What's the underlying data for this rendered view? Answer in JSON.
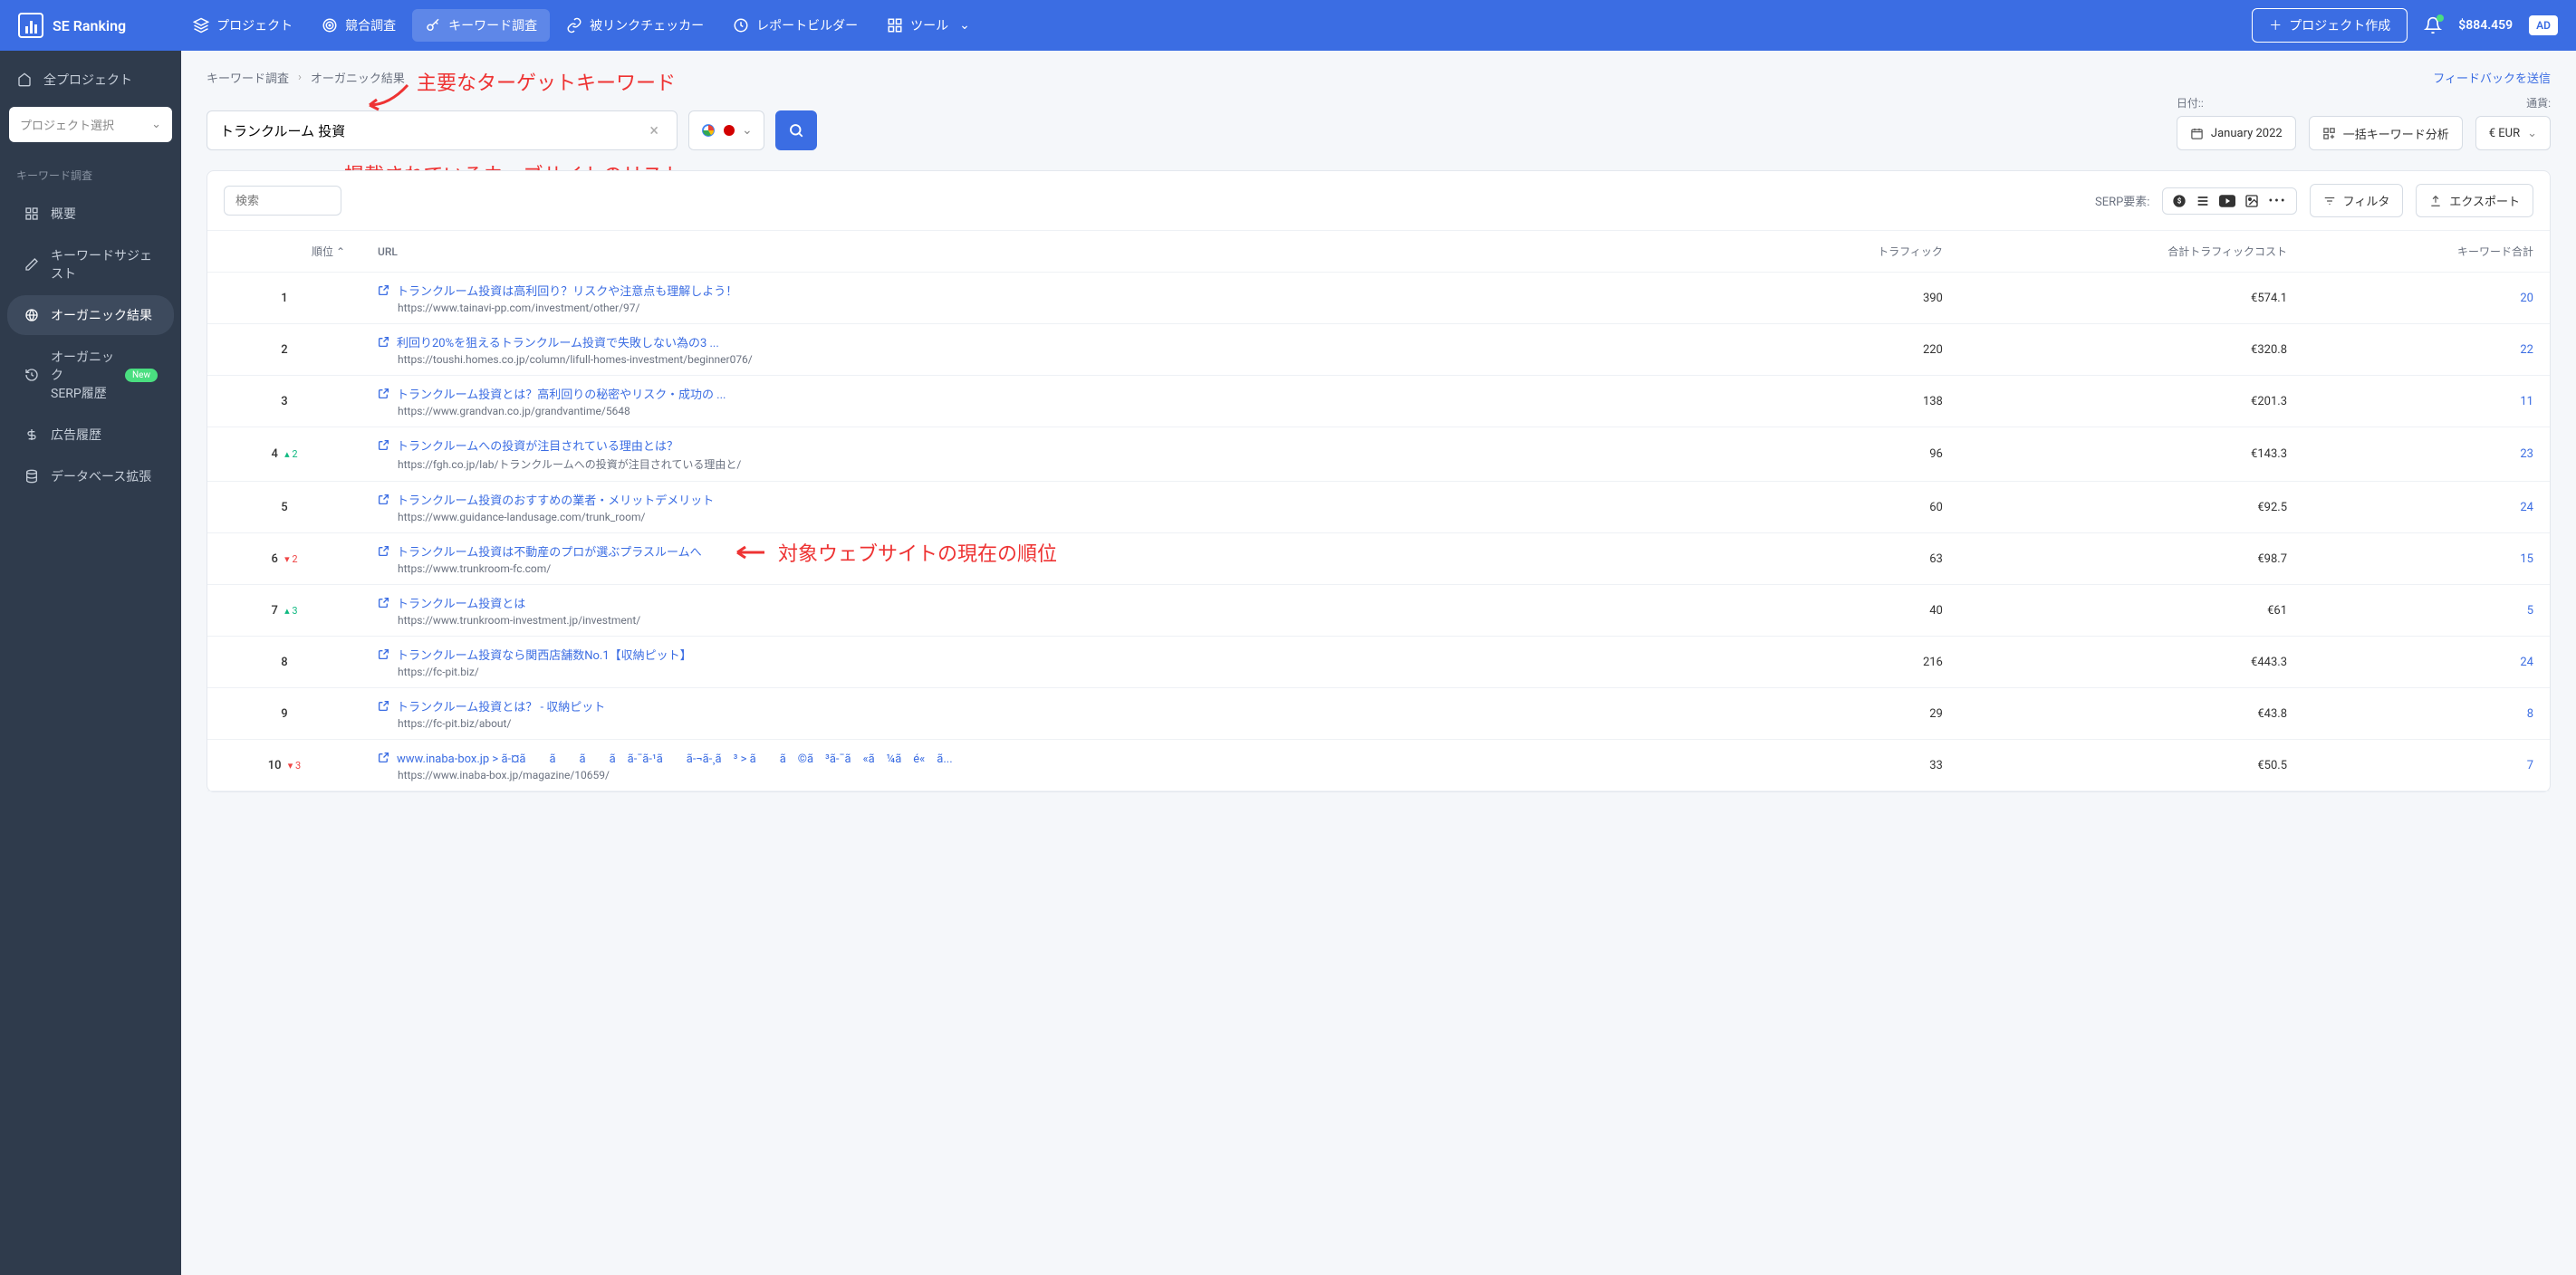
{
  "header": {
    "logo_text": "SE Ranking",
    "nav": [
      {
        "label": "プロジェクト",
        "icon": "layers"
      },
      {
        "label": "競合調査",
        "icon": "target"
      },
      {
        "label": "キーワード調査",
        "icon": "key",
        "active": true
      },
      {
        "label": "被リンクチェッカー",
        "icon": "link"
      },
      {
        "label": "レポートビルダー",
        "icon": "clock"
      },
      {
        "label": "ツール",
        "icon": "grid"
      }
    ],
    "create_project": "プロジェクト作成",
    "balance": "$884.459",
    "ad_badge": "AD"
  },
  "sidebar": {
    "all_projects": "全プロジェクト",
    "project_select_placeholder": "プロジェクト選択",
    "section_title": "キーワード調査",
    "items": [
      {
        "label": "概要",
        "icon": "grid"
      },
      {
        "label": "キーワードサジェスト",
        "icon": "pencil"
      },
      {
        "label": "オーガニック結果",
        "icon": "globe",
        "active": true
      },
      {
        "label": "オーガニック\nSERP履歴",
        "icon": "history",
        "badge": "New"
      },
      {
        "label": "広告履歴",
        "icon": "dollar"
      },
      {
        "label": "データベース拡張",
        "icon": "database"
      }
    ]
  },
  "breadcrumb": {
    "a": "キーワード調査",
    "b": "オーガニック結果"
  },
  "feedback": "フィードバックを送信",
  "keyword_input_value": "トランクルーム 投資",
  "date_label": "日付::",
  "date_value": "January 2022",
  "bulk_analysis": "一括キーワード分析",
  "currency_label": "通貨:",
  "currency_value": "€ EUR",
  "annotations": {
    "a1": "主要なターゲットキーワード",
    "a2": "掲載されているウェブサイトのリスト",
    "a3": "対象ウェブサイトの現在の順位"
  },
  "table": {
    "search_placeholder": "検索",
    "serp_label": "SERP要素:",
    "filter": "フィルタ",
    "export": "エクスポート",
    "cols": {
      "pos": "順位",
      "url": "URL",
      "traffic": "トラフィック",
      "cost": "合計トラフィックコスト",
      "kw": "キーワード合計"
    },
    "rows": [
      {
        "pos": "1",
        "title": "トランクルーム投資は高利回り？リスクや注意点も理解しよう！",
        "url": "https://www.tainavi-pp.com/investment/other/97/",
        "traffic": "390",
        "cost": "€574.1",
        "kw": "20"
      },
      {
        "pos": "2",
        "title": "利回り20%を狙えるトランクルーム投資で失敗しない為の3 ...",
        "url": "https://toushi.homes.co.jp/column/lifull-homes-investment/beginner076/",
        "traffic": "220",
        "cost": "€320.8",
        "kw": "22"
      },
      {
        "pos": "3",
        "title": "トランクルーム投資とは？高利回りの秘密やリスク・成功の ...",
        "url": "https://www.grandvan.co.jp/grandvantime/5648",
        "traffic": "138",
        "cost": "€201.3",
        "kw": "11"
      },
      {
        "pos": "4",
        "chg": "▴ 2",
        "chg_dir": "up",
        "title": "トランクルームへの投資が注目されている理由とは？",
        "url": "https://fgh.co.jp/lab/トランクルームへの投資が注目されている理由と/",
        "traffic": "96",
        "cost": "€143.3",
        "kw": "23"
      },
      {
        "pos": "5",
        "title": "トランクルーム投資のおすすめの業者・メリットデメリット",
        "url": "https://www.guidance-landusage.com/trunk_room/",
        "traffic": "60",
        "cost": "€92.5",
        "kw": "24"
      },
      {
        "pos": "6",
        "chg": "▾ 2",
        "chg_dir": "down",
        "title": "トランクルーム投資は不動産のプロが選ぶプラスルームへ",
        "url": "https://www.trunkroom-fc.com/",
        "traffic": "63",
        "cost": "€98.7",
        "kw": "15"
      },
      {
        "pos": "7",
        "chg": "▴ 3",
        "chg_dir": "up",
        "title": "トランクルーム投資とは",
        "url": "https://www.trunkroom-investment.jp/investment/",
        "traffic": "40",
        "cost": "€61",
        "kw": "5"
      },
      {
        "pos": "8",
        "title": "トランクルーム投資なら関西店舗数No.1【収納ピット】",
        "url": "https://fc-pit.biz/",
        "traffic": "216",
        "cost": "€443.3",
        "kw": "24"
      },
      {
        "pos": "9",
        "title": "トランクルーム投資とは？ - 収納ピット",
        "url": "https://fc-pit.biz/about/",
        "traffic": "29",
        "cost": "€43.8",
        "kw": "8"
      },
      {
        "pos": "10",
        "chg": "▾ 3",
        "chg_dir": "down",
        "title": "www.inaba-box.jp > ã-¤ã　　ã　　ã　　ã　ã-¯ã-¹ã　　ã-¬ã-¸ã　³ > ã　　ã　©ã　³ã-¯ã　«ã　¼ã　é«　ã...",
        "url": "https://www.inaba-box.jp/magazine/10659/",
        "traffic": "33",
        "cost": "€50.5",
        "kw": "7"
      }
    ]
  }
}
